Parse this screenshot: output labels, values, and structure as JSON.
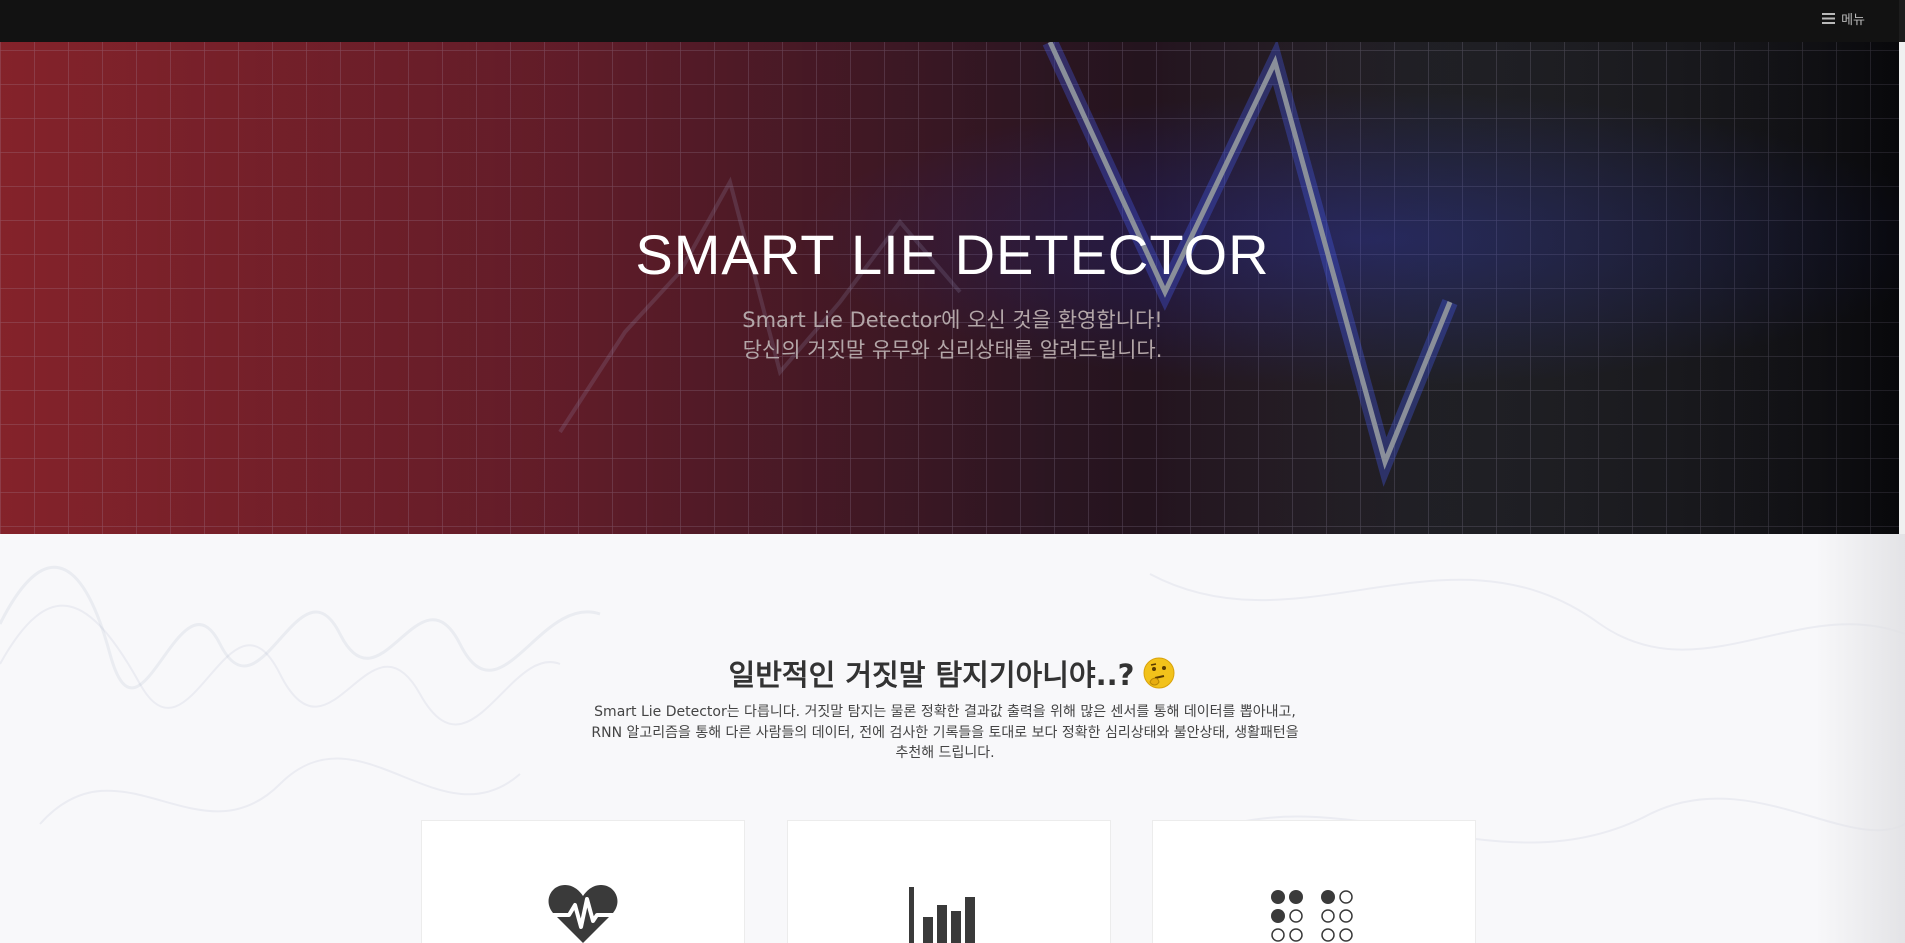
{
  "topbar": {
    "menu_label": "메뉴",
    "menu_icon": "hamburger-icon"
  },
  "hero": {
    "title": "SMART LIE DETECTOR",
    "subtitle_line1": "Smart Lie Detector에 오신 것을 환영합니다!",
    "subtitle_line2": "당신의 거짓말 유무와 심리상태를 알려드립니다."
  },
  "intro": {
    "heading": "일반적인 거짓말 탐지기아니야..?",
    "heading_icon": "thinking-face-icon",
    "text_line1": "Smart Lie Detector는 다릅니다. 거짓말 탐지는 물론 정확한 결과값 출력을 위해 많은 센서를 통해 데이터를 뽑아내고,",
    "text_line2": "RNN 알고리즘을 통해 다른 사람들의 데이터, 전에 검사한 기록들을 토대로 보다 정확한 심리상태와 불안상태, 생활패턴을",
    "text_line3": "추천해 드립니다."
  },
  "cards": [
    {
      "icon": "heartbeat-icon"
    },
    {
      "icon": "bar-chart-icon"
    },
    {
      "icon": "braille-dots-icon"
    }
  ],
  "colors": {
    "topbar": "#121212",
    "hero_red": "#7a1018",
    "hero_dark": "#0a0a0e",
    "accent_blue": "#3a4fd0",
    "text_dark": "#333333"
  }
}
